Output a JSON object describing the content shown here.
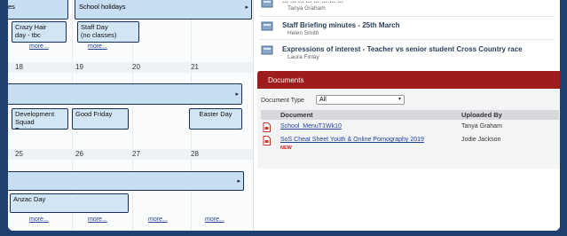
{
  "calendar": {
    "top_events": {
      "left_fragment": "es",
      "holidays_band": "School holidays",
      "crazy_hair": "Crazy Hair\nday - tbc",
      "staff_day": "Staff Day\n(no classes)",
      "more1": "more...",
      "more2": "more..."
    },
    "week2": {
      "days": [
        "18",
        "19",
        "20",
        "21"
      ],
      "events": {
        "development": "Development\nSquad\nTraining",
        "good_friday": "Good Friday",
        "easter_day": "Easter Day"
      }
    },
    "week3": {
      "days": [
        "25",
        "26",
        "27",
        "28"
      ],
      "events": {
        "anzac": "Anzac Day"
      },
      "more": [
        "more...",
        "more...",
        "more...",
        "more..."
      ]
    },
    "arrow": "▸"
  },
  "notices": [
    {
      "title": "... ... ... ... ... ... ... ...",
      "sub": "Tanya Graham"
    },
    {
      "title": "Staff Briefing minutes - 25th March",
      "sub": "Helen Smith"
    },
    {
      "title": "Expressions of interest - Teacher vs senior student Cross Country race",
      "sub": "Laura Finlay"
    }
  ],
  "documents": {
    "header": "Documents",
    "filter_label": "Document Type",
    "filter_value": "All",
    "columns": [
      "Document",
      "Uploaded By"
    ],
    "rows": [
      {
        "name": "School_MenuT1Wk10",
        "by": "Tanya Graham",
        "new": ""
      },
      {
        "name": "SoS Cheat Sheet Youth & Online Pornography 2019",
        "by": "Jodie Jackson",
        "new": "NEW"
      }
    ]
  },
  "colors": {
    "frame": "#1f3f70",
    "docs_header": "#9f1c1c",
    "event_fill": "#d2e5f5",
    "link": "#1f3f9a"
  }
}
